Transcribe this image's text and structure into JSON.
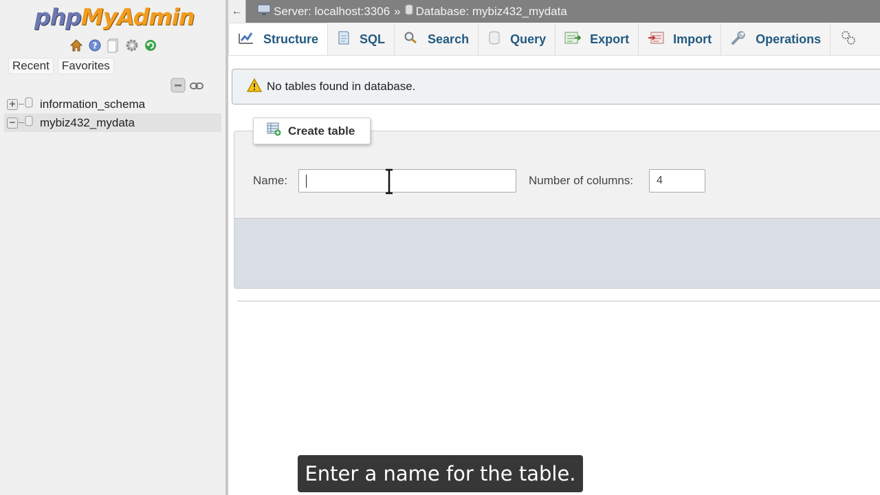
{
  "navigation": {
    "logo": {
      "part1": "php",
      "part2": "MyAdmin"
    },
    "icons": [
      "home-icon",
      "info-icon",
      "docs-icon",
      "settings-icon",
      "reload-icon"
    ],
    "tabs": [
      {
        "label": "Recent"
      },
      {
        "label": "Favorites"
      }
    ],
    "tools": [
      "collapse-all-icon",
      "link-icon"
    ],
    "databases": [
      {
        "name": "information_schema",
        "expander": "+",
        "selected": false
      },
      {
        "name": "mybiz432_mydata",
        "expander": "−",
        "selected": true
      }
    ]
  },
  "topbar": {
    "back_label": "←",
    "server": "Server: localhost:3306",
    "separator": "»",
    "database": "Database: mybiz432_mydata"
  },
  "tabs": [
    {
      "label": "Structure",
      "icon": "structure-icon",
      "active": true
    },
    {
      "label": "SQL",
      "icon": "sql-icon"
    },
    {
      "label": "Search",
      "icon": "search-icon"
    },
    {
      "label": "Query",
      "icon": "query-icon"
    },
    {
      "label": "Export",
      "icon": "export-icon"
    },
    {
      "label": "Import",
      "icon": "import-icon"
    },
    {
      "label": "Operations",
      "icon": "wrench-icon"
    },
    {
      "label": "",
      "icon": "more-icon"
    }
  ],
  "notice": {
    "text": "No tables found in database.",
    "icon": "warning-icon"
  },
  "create_table": {
    "legend": "Create table",
    "name_label": "Name:",
    "name_value": "",
    "columns_label": "Number of columns:",
    "columns_value": "4"
  },
  "caption": "Enter a name for the table.",
  "colors": {
    "tab_text": "#235a81",
    "topbar_bg": "#808080",
    "logo_php": "#6c78af",
    "logo_myadmin": "#f29c1f"
  }
}
